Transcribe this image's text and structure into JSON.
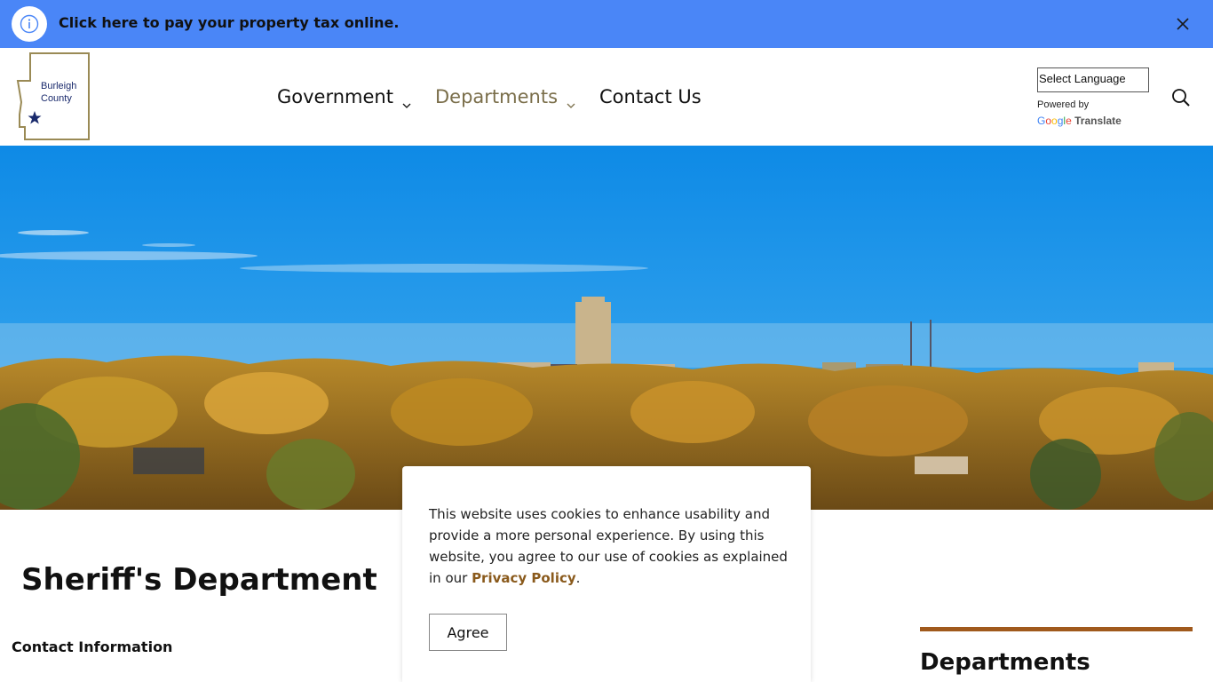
{
  "alert": {
    "text": "Click here to pay your property tax online."
  },
  "logo": {
    "line1": "Burleigh",
    "line2": "County"
  },
  "nav": {
    "items": [
      {
        "label": "Government",
        "has_dropdown": true
      },
      {
        "label": "Departments",
        "has_dropdown": true,
        "active": true
      },
      {
        "label": "Contact Us",
        "has_dropdown": false
      }
    ]
  },
  "translate": {
    "select_label": "Select Language",
    "powered_by": "Powered by",
    "google": "Google",
    "translate_word": "Translate"
  },
  "page": {
    "title": "Sheriff's Department",
    "contact_heading": "Contact Information"
  },
  "sidebar": {
    "heading": "Departments"
  },
  "cookie": {
    "text_before": "This website uses cookies to enhance usability and provide a more personal experience. By using this website, you agree to our use of cookies as explained in our ",
    "link": "Privacy Policy",
    "text_after": ".",
    "agree": "Agree"
  },
  "colors": {
    "alert_bar": "#4a86f7",
    "nav_active": "#7a6e4a",
    "accent_rule": "#a0591c",
    "policy_link": "#8a5a1c"
  }
}
